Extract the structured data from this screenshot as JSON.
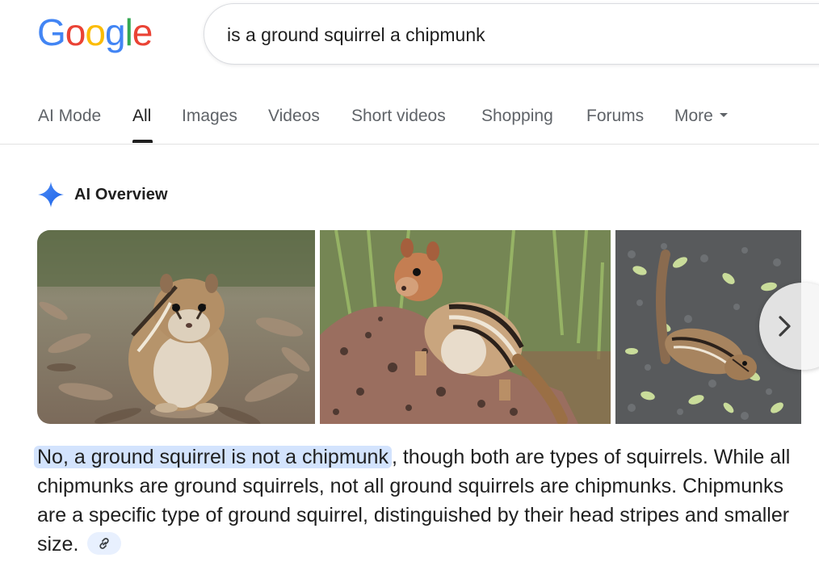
{
  "logo": {
    "letters": [
      "G",
      "o",
      "o",
      "g",
      "l",
      "e"
    ],
    "colors": [
      "#4285F4",
      "#EA4335",
      "#FBBC05",
      "#4285F4",
      "#34A853",
      "#EA4335"
    ]
  },
  "search": {
    "query": "is a ground squirrel a chipmunk"
  },
  "tabs": [
    {
      "label": "AI Mode"
    },
    {
      "label": "All"
    },
    {
      "label": "Images"
    },
    {
      "label": "Videos"
    },
    {
      "label": "Short videos"
    },
    {
      "label": "Shopping"
    },
    {
      "label": "Forums"
    },
    {
      "label": "More"
    }
  ],
  "active_tab": "All",
  "ai_overview": {
    "label": "AI Overview",
    "icon": "sparkle-icon",
    "images": [
      {
        "icon": "chipmunk-on-wood-chips-photo"
      },
      {
        "icon": "golden-mantled-ground-squirrel-on-rock-photo"
      },
      {
        "icon": "chipmunk-on-gravel-photo"
      }
    ],
    "answer_highlight": "No, a ground squirrel is not a chipmunk",
    "answer_rest": ", though both are types of squirrels. While all chipmunks are ground squirrels, not all ground squirrels are chipmunks. Chipmunks are a specific type of ground squirrel, distinguished by their head stripes and smaller size.",
    "citation_icon": "link-icon",
    "next_icon": "chevron-right-icon"
  },
  "colors": {
    "accent_blue": "#4285F4",
    "highlight": "#d3e3fd",
    "text": "#1f1f1f",
    "muted": "#5f6368"
  }
}
